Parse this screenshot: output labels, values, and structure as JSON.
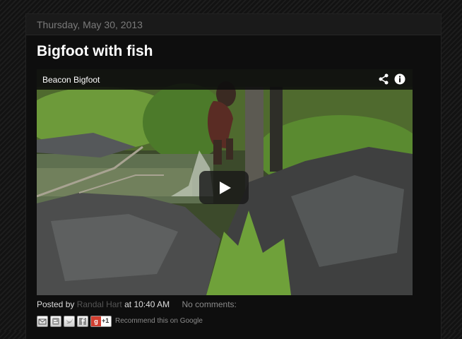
{
  "post": {
    "date": "Thursday, May 30, 2013",
    "title": "Bigfoot with fish"
  },
  "video": {
    "title": "Beacon Bigfoot",
    "icons": [
      "share-icon",
      "info-icon",
      "play-icon"
    ]
  },
  "footer": {
    "posted_by": "Posted by",
    "author": "Randal Hart",
    "at": "at",
    "time": "10:40 AM",
    "comments": "No comments:"
  },
  "share": {
    "buttons": [
      "email-icon",
      "blogger-icon",
      "twitter-icon",
      "facebook-icon"
    ],
    "gplus_label": "+1",
    "recommend": "Recommend this on Google"
  }
}
